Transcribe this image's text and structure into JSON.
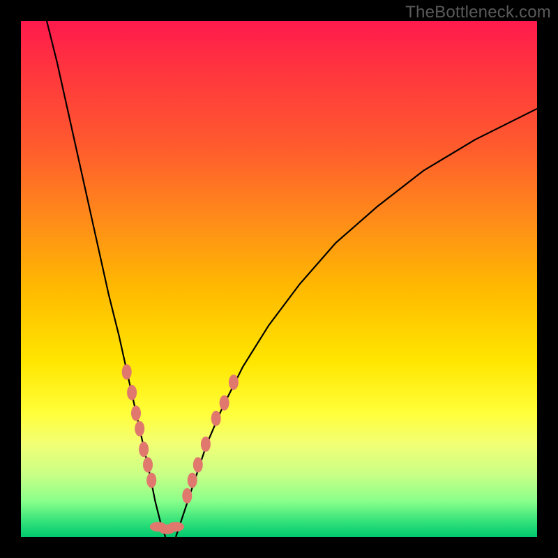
{
  "watermark": "TheBottleneck.com",
  "chart_data": {
    "type": "line",
    "title": "",
    "xlabel": "",
    "ylabel": "",
    "xlim": [
      0,
      100
    ],
    "ylim": [
      0,
      100
    ],
    "notes": "Two curve branches descending to a minimum near x≈26-30 at y≈0; background is a vertical red→green heat gradient.",
    "series": [
      {
        "name": "left-branch",
        "x": [
          5,
          7,
          9,
          11,
          13,
          15,
          17,
          19,
          21,
          23,
          25,
          26,
          27,
          28
        ],
        "y": [
          100,
          92,
          83,
          74,
          65,
          56,
          47,
          39,
          30,
          21,
          12,
          7,
          3,
          0
        ]
      },
      {
        "name": "right-branch",
        "x": [
          30,
          31,
          32,
          34,
          36,
          39,
          43,
          48,
          54,
          61,
          69,
          78,
          88,
          100
        ],
        "y": [
          0,
          3,
          6,
          12,
          18,
          25,
          33,
          41,
          49,
          57,
          64,
          71,
          77,
          83
        ]
      }
    ],
    "markers": {
      "left_branch": [
        {
          "x": 20.5,
          "y": 32
        },
        {
          "x": 21.5,
          "y": 28
        },
        {
          "x": 22.3,
          "y": 24
        },
        {
          "x": 23.0,
          "y": 21
        },
        {
          "x": 23.8,
          "y": 17
        },
        {
          "x": 24.6,
          "y": 14
        },
        {
          "x": 25.3,
          "y": 11
        }
      ],
      "bottom": [
        {
          "x": 26.6,
          "y": 2.0
        },
        {
          "x": 28.3,
          "y": 1.5
        },
        {
          "x": 30.0,
          "y": 2.0
        }
      ],
      "right_branch": [
        {
          "x": 32.2,
          "y": 8
        },
        {
          "x": 33.2,
          "y": 11
        },
        {
          "x": 34.3,
          "y": 14
        },
        {
          "x": 35.8,
          "y": 18
        },
        {
          "x": 37.8,
          "y": 23
        },
        {
          "x": 39.4,
          "y": 26
        },
        {
          "x": 41.2,
          "y": 30
        }
      ]
    }
  }
}
